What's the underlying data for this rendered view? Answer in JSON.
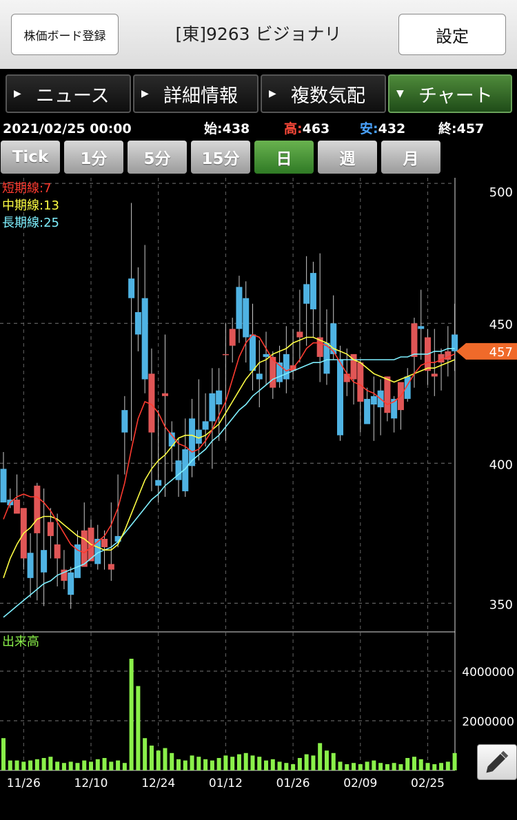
{
  "header": {
    "register_button": "株価ボード登録",
    "title": "[東]9263 ビジョナリ",
    "settings_button": "設定"
  },
  "nav_tabs": [
    {
      "label": "ニュース",
      "active": false,
      "arrow": "right"
    },
    {
      "label": "詳細情報",
      "active": false,
      "arrow": "right"
    },
    {
      "label": "複数気配",
      "active": false,
      "arrow": "right"
    },
    {
      "label": "チャート",
      "active": true,
      "arrow": "down"
    }
  ],
  "quote": {
    "datetime": "2021/02/25 00:00",
    "open_label": "始:",
    "open": "438",
    "high_label": "高:",
    "high": "463",
    "low_label": "安:",
    "low": "432",
    "close_label": "終:",
    "close": "457",
    "colors": {
      "high": "#ff4a3a",
      "low": "#4aa3ff"
    }
  },
  "periods": [
    {
      "label": "Tick",
      "active": false
    },
    {
      "label": "1分",
      "active": false
    },
    {
      "label": "5分",
      "active": false
    },
    {
      "label": "15分",
      "active": false
    },
    {
      "label": "日",
      "active": true
    },
    {
      "label": "週",
      "active": false
    },
    {
      "label": "月",
      "active": false
    }
  ],
  "legend": {
    "short": "短期線:7",
    "mid": "中期線:13",
    "long": "長期線:25",
    "volume": "出来高"
  },
  "colors": {
    "up": "#e05656",
    "down": "#4fb3e3",
    "ma_short": "#ff3b30",
    "ma_mid": "#ffff44",
    "ma_long": "#7ff0ff",
    "volume": "#8af04a",
    "price_marker": "#f06a2a",
    "active_green": "#3f8f2e"
  },
  "icons": {
    "pencil": "pencil-icon",
    "tab_arrow": "triangle-icon"
  },
  "chart_data": {
    "type": "candlestick",
    "ylim": [
      340,
      502
    ],
    "y_ticks": [
      500,
      450,
      400,
      350
    ],
    "current_price_label": "457",
    "x_labels": [
      "11/26",
      "12/10",
      "12/24",
      "01/12",
      "01/26",
      "02/09",
      "02/25"
    ],
    "x_label_index": [
      3,
      13,
      23,
      33,
      43,
      53,
      63
    ],
    "candles": [
      [
        398,
        404,
        386,
        386
      ],
      [
        387,
        391,
        384,
        385
      ],
      [
        382,
        396,
        383,
        387
      ],
      [
        366,
        382,
        362,
        384
      ],
      [
        368,
        375,
        352,
        359
      ],
      [
        375,
        393,
        351,
        392
      ],
      [
        369,
        391,
        349,
        361
      ],
      [
        374,
        384,
        366,
        379
      ],
      [
        366,
        382,
        356,
        371
      ],
      [
        358,
        369,
        355,
        362
      ],
      [
        361,
        363,
        348,
        353
      ],
      [
        371,
        376,
        361,
        359
      ],
      [
        363,
        386,
        364,
        376
      ],
      [
        365,
        380,
        370,
        377
      ],
      [
        373,
        378,
        362,
        364
      ],
      [
        370,
        376,
        362,
        373
      ],
      [
        362,
        386,
        358,
        364
      ],
      [
        374,
        396,
        370,
        372
      ],
      [
        419,
        424,
        396,
        411
      ],
      [
        466,
        493,
        408,
        459
      ],
      [
        454,
        470,
        440,
        446
      ],
      [
        459,
        478,
        425,
        430
      ],
      [
        411,
        441,
        390,
        432
      ],
      [
        394,
        419,
        386,
        392
      ],
      [
        424,
        446,
        388,
        425
      ],
      [
        411,
        415,
        397,
        406
      ],
      [
        401,
        409,
        388,
        394
      ],
      [
        405,
        416,
        388,
        390
      ],
      [
        416,
        423,
        395,
        399
      ],
      [
        412,
        430,
        401,
        407
      ],
      [
        415,
        425,
        406,
        412
      ],
      [
        425,
        434,
        398,
        415
      ],
      [
        426,
        434,
        408,
        421
      ],
      [
        439,
        450,
        408,
        439
      ],
      [
        442,
        452,
        436,
        448
      ],
      [
        463,
        467,
        443,
        448
      ],
      [
        459,
        465,
        436,
        445
      ],
      [
        446,
        457,
        426,
        433
      ],
      [
        432,
        444,
        420,
        430
      ],
      [
        439,
        447,
        428,
        438
      ],
      [
        427,
        440,
        423,
        438
      ],
      [
        436,
        442,
        427,
        429
      ],
      [
        439,
        449,
        425,
        430
      ],
      [
        433,
        448,
        430,
        435
      ],
      [
        445,
        462,
        436,
        447
      ],
      [
        464,
        474,
        442,
        457
      ],
      [
        468,
        472,
        445,
        455
      ],
      [
        438,
        475,
        429,
        445
      ],
      [
        443,
        455,
        428,
        432
      ],
      [
        450,
        460,
        437,
        439
      ],
      [
        437,
        442,
        408,
        410
      ],
      [
        429,
        441,
        424,
        432
      ],
      [
        430,
        434,
        421,
        439
      ],
      [
        422,
        437,
        411,
        436
      ],
      [
        423,
        427,
        417,
        414
      ],
      [
        424,
        431,
        408,
        421
      ],
      [
        426,
        430,
        410,
        420
      ],
      [
        418,
        431,
        415,
        431
      ],
      [
        423,
        424,
        411,
        416
      ],
      [
        419,
        428,
        412,
        429
      ],
      [
        431,
        434,
        422,
        423
      ],
      [
        438,
        452,
        427,
        450
      ],
      [
        449,
        462,
        437,
        448
      ],
      [
        433,
        448,
        428,
        445
      ],
      [
        431,
        448,
        424,
        432
      ],
      [
        436,
        441,
        426,
        439
      ],
      [
        437,
        449,
        431,
        440
      ],
      [
        446,
        457,
        433,
        440
      ]
    ],
    "ma_short": [
      380,
      386,
      388,
      389,
      388,
      388,
      386,
      383,
      379,
      375,
      371,
      369,
      368,
      370,
      372,
      374,
      378,
      384,
      393,
      405,
      416,
      422,
      421,
      418,
      413,
      410,
      407,
      406,
      404,
      405,
      408,
      412,
      417,
      422,
      430,
      438,
      443,
      446,
      445,
      441,
      437,
      435,
      433,
      434,
      437,
      441,
      443,
      443,
      442,
      440,
      436,
      432,
      429,
      428,
      426,
      425,
      423,
      421,
      422,
      424,
      428,
      432,
      435,
      436,
      436,
      437,
      438,
      439
    ],
    "ma_mid": [
      359,
      366,
      371,
      375,
      377,
      380,
      381,
      381,
      380,
      378,
      376,
      374,
      373,
      371,
      370,
      369,
      369,
      371,
      376,
      382,
      388,
      394,
      398,
      401,
      403,
      406,
      409,
      410,
      410,
      409,
      410,
      412,
      414,
      418,
      422,
      426,
      430,
      433,
      436,
      437,
      439,
      440,
      441,
      443,
      444,
      445,
      445,
      444,
      443,
      441,
      440,
      439,
      437,
      436,
      434,
      432,
      431,
      430,
      429,
      430,
      431,
      432,
      433,
      434,
      434,
      435,
      436,
      437
    ],
    "ma_long": [
      345,
      347,
      349,
      351,
      353,
      355,
      357,
      358,
      360,
      361,
      362,
      363,
      364,
      366,
      368,
      369,
      370,
      372,
      375,
      378,
      381,
      384,
      387,
      389,
      392,
      394,
      396,
      398,
      401,
      403,
      405,
      408,
      410,
      413,
      416,
      419,
      421,
      424,
      426,
      428,
      430,
      431,
      432,
      433,
      434,
      435,
      436,
      436,
      437,
      437,
      437,
      437,
      437,
      437,
      437,
      437,
      437,
      437,
      437,
      438,
      438,
      439,
      439,
      439,
      440,
      440,
      441,
      441
    ],
    "volume": {
      "ylim": [
        0,
        5000000
      ],
      "y_ticks": [
        4000000,
        2000000
      ],
      "y_tick_labels": [
        "4000000",
        "2000000"
      ],
      "values": [
        1300000,
        400000,
        400000,
        350000,
        400000,
        450000,
        500000,
        550000,
        350000,
        300000,
        350000,
        300000,
        400000,
        350000,
        450000,
        500000,
        350000,
        400000,
        300000,
        4500000,
        3400000,
        1300000,
        1000000,
        800000,
        900000,
        700000,
        450000,
        400000,
        600000,
        550000,
        450000,
        400000,
        500000,
        600000,
        550000,
        650000,
        700000,
        600000,
        550000,
        400000,
        450000,
        350000,
        300000,
        250000,
        500000,
        650000,
        600000,
        1100000,
        800000,
        700000,
        350000,
        250000,
        300000,
        250000,
        350000,
        400000,
        300000,
        250000,
        300000,
        250000,
        500000,
        550000,
        450000,
        300000,
        250000,
        300000,
        350000,
        700000
      ]
    }
  }
}
